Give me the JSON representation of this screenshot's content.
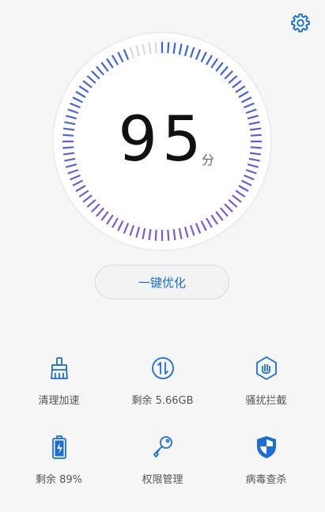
{
  "header": {
    "settings_icon": "gear-icon"
  },
  "score": {
    "value": "95",
    "unit": "分",
    "level": 95
  },
  "primary_action": {
    "label": "一键优化"
  },
  "tiles": [
    {
      "label": "清理加速",
      "icon": "broom-icon"
    },
    {
      "label": "剩余 5.66GB",
      "icon": "data-transfer-icon"
    },
    {
      "label": "骚扰拦截",
      "icon": "hand-shield-icon"
    },
    {
      "label": "剩余 89%",
      "icon": "battery-icon"
    },
    {
      "label": "权限管理",
      "icon": "key-icon"
    },
    {
      "label": "病毒查杀",
      "icon": "shield-icon"
    }
  ],
  "colors": {
    "accent": "#1a6ed8",
    "gauge_top": "#3a63e0",
    "gauge_bottom": "#7a5ad8",
    "track": "#d8d8d8"
  }
}
